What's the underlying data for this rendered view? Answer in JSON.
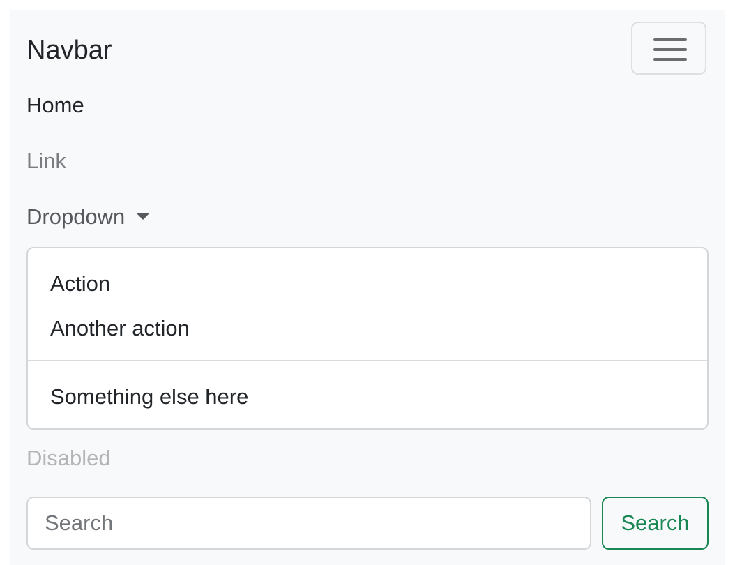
{
  "navbar": {
    "brand": "Navbar",
    "toggler_icon": "hamburger-icon",
    "links": {
      "home": "Home",
      "link": "Link",
      "dropdown": "Dropdown",
      "disabled": "Disabled"
    },
    "dropdown_menu": {
      "items": [
        "Action",
        "Another action",
        "Something else here"
      ]
    },
    "search": {
      "placeholder": "Search",
      "value": "",
      "button_label": "Search"
    }
  },
  "colors": {
    "navbar_bg": "#f8f9fa",
    "search_button": "#198754",
    "disabled_text": "#b2b4b6"
  }
}
